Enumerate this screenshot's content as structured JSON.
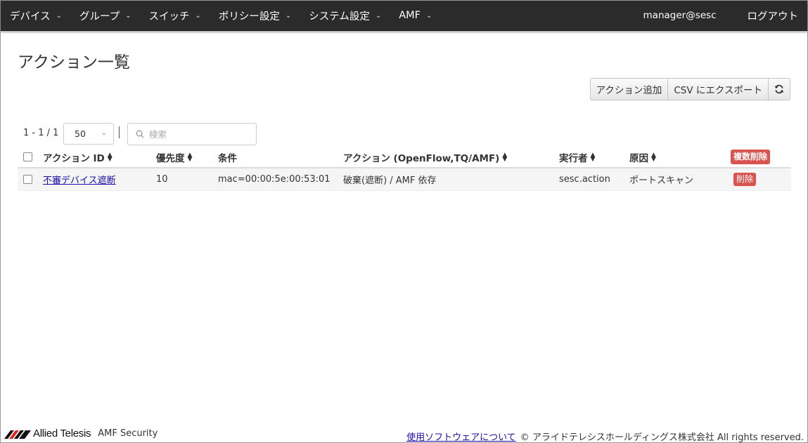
{
  "nav": {
    "items": [
      {
        "label": "デバイス"
      },
      {
        "label": "グループ"
      },
      {
        "label": "スイッチ"
      },
      {
        "label": "ポリシー設定"
      },
      {
        "label": "システム設定"
      },
      {
        "label": "AMF"
      }
    ],
    "user": "manager@sesc",
    "logout": "ログアウト"
  },
  "page": {
    "title": "アクション一覧"
  },
  "toolbar": {
    "add_label": "アクション追加",
    "export_label": "CSV にエクスポート",
    "refresh_icon": "refresh-icon"
  },
  "pager": {
    "info": "1 - 1 / 1",
    "page_size": "50",
    "search_placeholder": "検索"
  },
  "table": {
    "headers": {
      "action_id": "アクション ID",
      "priority": "優先度",
      "condition": "条件",
      "action": "アクション (OpenFlow,TQ/AMF)",
      "executor": "実行者",
      "cause": "原因",
      "bulk_delete": "複数削除"
    },
    "rows": [
      {
        "action_id": "不審デバイス遮断",
        "priority": "10",
        "condition": "mac=00:00:5e:00:53:01",
        "action": "破棄(遮断) / AMF 依存",
        "executor": "sesc.action",
        "cause": "ポートスキャン",
        "delete": "削除"
      }
    ]
  },
  "footer": {
    "logo_text": "Allied Telesis",
    "product": "AMF Security",
    "about_link": "使用ソフトウェアについて",
    "copyright": "© アライドテレシスホールディングス株式会社 All rights reserved."
  },
  "colors": {
    "navbar": "#2b2b2b",
    "danger": "#d9534f",
    "link": "#1a0dab",
    "logo_red": "#e2231a"
  }
}
